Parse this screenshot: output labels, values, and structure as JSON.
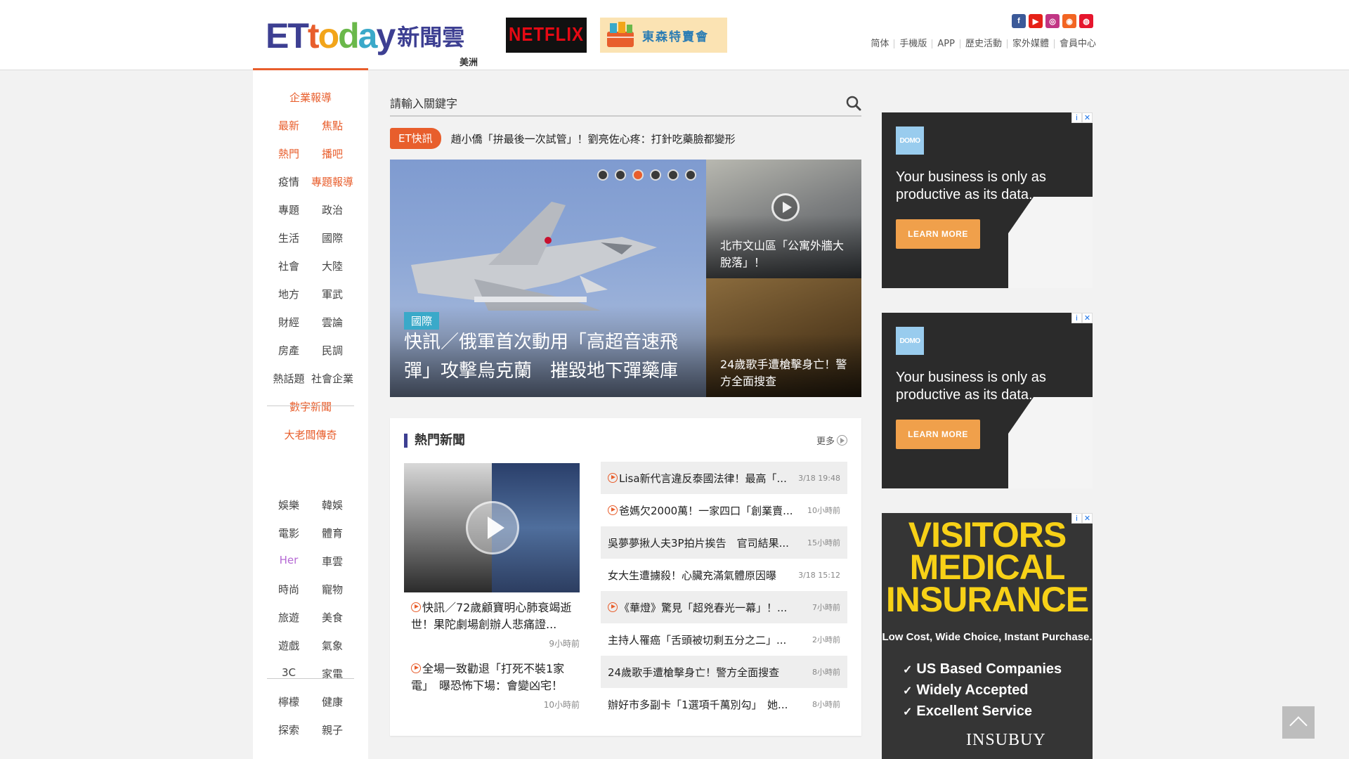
{
  "logo": {
    "brand": "ETtoday新聞雲",
    "et": "ET",
    "today_letters": [
      "t",
      "o",
      "d",
      "a",
      "y"
    ],
    "cn": "新聞雲",
    "region": "美洲"
  },
  "colors": {
    "accent": "#e85e2c",
    "brand": "#3d3f92",
    "today": [
      "#e85e2c",
      "#f2a51a",
      "#6ab84a",
      "#3aa9c9",
      "#3d3f92"
    ]
  },
  "ads_top": {
    "netflix": "NETFLIX",
    "sale": "東森特賣會"
  },
  "social": [
    {
      "icon": "facebook-icon",
      "glyph": "f",
      "color": "#3b5998"
    },
    {
      "icon": "youtube-icon",
      "glyph": "▶",
      "color": "#e62117"
    },
    {
      "icon": "instagram-icon",
      "glyph": "◎",
      "color": "#c13584"
    },
    {
      "icon": "rss-icon",
      "glyph": "◉",
      "color": "#f26522"
    },
    {
      "icon": "weibo-icon",
      "glyph": "◍",
      "color": "#e6162d"
    }
  ],
  "toplinks": [
    "简体",
    "手機版",
    "APP",
    "歷史活動",
    "家外媒體",
    "會員中心"
  ],
  "sidebar": {
    "rows": [
      [
        "企業報導"
      ],
      [
        "最新",
        "焦點"
      ],
      [
        "熱門",
        "播吧"
      ],
      [
        "疫情",
        "專題報導"
      ],
      [
        "專題",
        "政治"
      ],
      [
        "生活",
        "國際"
      ],
      [
        "社會",
        "大陸"
      ],
      [
        "地方",
        "軍武"
      ],
      [
        "財經",
        "雲論"
      ],
      [
        "房產",
        "民調"
      ],
      [
        "熱話題",
        "社會企業"
      ],
      [
        "數字新聞"
      ],
      [
        "大老闆傳奇"
      ],
      [
        "娛樂",
        "韓娛"
      ],
      [
        "電影",
        "體育"
      ],
      [
        "Her",
        "車雲"
      ],
      [
        "時尚",
        "寵物"
      ],
      [
        "旅遊",
        "美食"
      ],
      [
        "遊戲",
        "氣象"
      ],
      [
        "3C",
        "家電"
      ],
      [
        "檸檬",
        "健康"
      ],
      [
        "探索",
        "親子"
      ]
    ]
  },
  "search": {
    "placeholder": "請輸入關鍵字"
  },
  "flash": {
    "tag": "ET快訊",
    "text": "趙小僑「拚最後一次試管」！劉亮佐心疼：打針吃藥臉都變形"
  },
  "hero": {
    "tag": "國際",
    "title": "快訊／俄軍首次動用「高超音速飛彈」攻擊烏克蘭　摧毀地下彈藥庫",
    "slides_total": 6,
    "active_slide": 3
  },
  "side_news": [
    {
      "title": "北市文山區「公寓外牆大脫落」！"
    },
    {
      "title": "24歲歌手遭槍擊身亡！警方全面搜查"
    }
  ],
  "hot": {
    "title": "熱門新聞",
    "more": "更多",
    "featured": [
      {
        "text": "快訊／72歲顧寶明心肺衰竭逝世！果陀劇場創辦人悲痛證...",
        "time": "9小時前",
        "video": true
      },
      {
        "text": "全場一致勸退「打死不裝1家電」　曝恐怖下場：會變凶宅！",
        "time": "10小時前",
        "video": true
      }
    ],
    "list": [
      {
        "title": "Lisa新代言違反泰國法律！最高「...",
        "time": "3/18 19:48",
        "video": true
      },
      {
        "title": "爸媽欠2000萬！一家四口「創業賣...",
        "time": "10小時前",
        "video": true
      },
      {
        "title": "吳夢夢揪人夫3P拍片挨告　官司結果...",
        "time": "15小時前",
        "video": false
      },
      {
        "title": "女大生遭擄殺！心臟充滿氣體原因曝",
        "time": "3/18 15:12",
        "video": false
      },
      {
        "title": "《華燈》驚見「超兇春光一幕」！...",
        "time": "7小時前",
        "video": true
      },
      {
        "title": "主持人罹癌「舌頭被切剩五分之二」...",
        "time": "2小時前",
        "video": false
      },
      {
        "title": "24歲歌手遭槍擊身亡！警方全面搜查",
        "time": "8小時前",
        "video": false
      },
      {
        "title": "辦好市多副卡「1選項千萬別勾」　她...",
        "time": "8小時前",
        "video": false
      }
    ]
  },
  "ads_side": {
    "domo": {
      "logo": "DOMO",
      "copy": "Your business is only as productive as its data.",
      "cta": "LEARN MORE"
    },
    "insurance": {
      "headline": "VISITORS MEDICAL INSURANCE",
      "sub": "Low Cost, Wide Choice, Instant Purchase.",
      "bullets": [
        "US Based Companies",
        "Widely Accepted",
        "Excellent Service"
      ],
      "brand": "INSUBUY"
    },
    "adchoice": "i",
    "close": "✕"
  }
}
